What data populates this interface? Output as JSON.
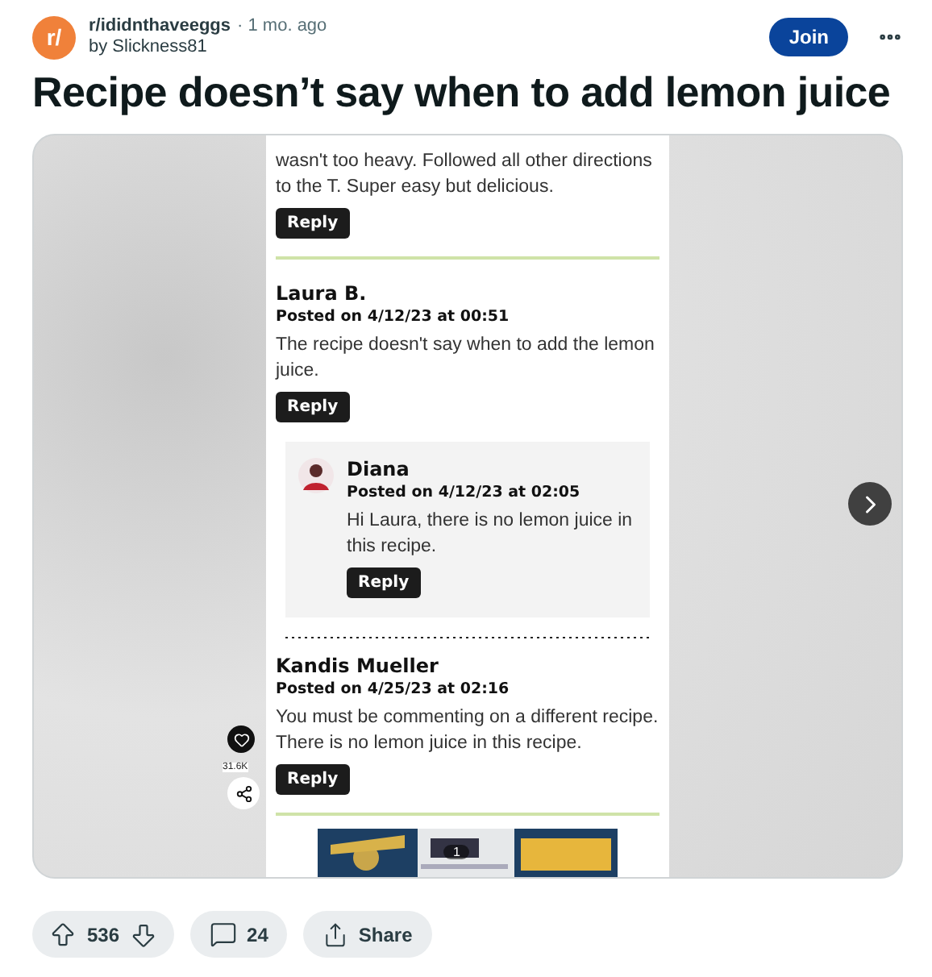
{
  "post": {
    "avatar_text": "r/",
    "subreddit": "r/ididnthaveeggs",
    "age": "· 1 mo. ago",
    "author": "by Slickness81",
    "join": "Join",
    "title": "Recipe doesn’t say when to add lemon juice"
  },
  "screenshot": {
    "comments": [
      {
        "kind": "tail",
        "body": "wasn't too heavy. Followed all other directions to the T. Super easy but delicious.",
        "reply": "Reply"
      },
      {
        "kind": "rule"
      },
      {
        "kind": "comment",
        "name": "Laura B.",
        "posted": "Posted on 4/12/23 at 00:51",
        "body": "The recipe doesn't say when to add the lemon juice.",
        "reply": "Reply"
      },
      {
        "kind": "reply",
        "name": "Diana",
        "posted": "Posted on 4/12/23 at 02:05",
        "body": "Hi Laura, there is no lemon juice in this recipe.",
        "reply": "Reply"
      },
      {
        "kind": "ticks"
      },
      {
        "kind": "comment",
        "name": "Kandis Mueller",
        "posted": "Posted on 4/25/23 at 02:16",
        "body": "You must be commenting on a different recipe. There is no lemon juice in this recipe.",
        "reply": "Reply"
      },
      {
        "kind": "rule"
      }
    ],
    "like_count": "31.6K",
    "ad": {
      "kind": "picture",
      "page": "1"
    }
  },
  "actions": {
    "votes": "536",
    "comments": "24",
    "share": "Share"
  }
}
